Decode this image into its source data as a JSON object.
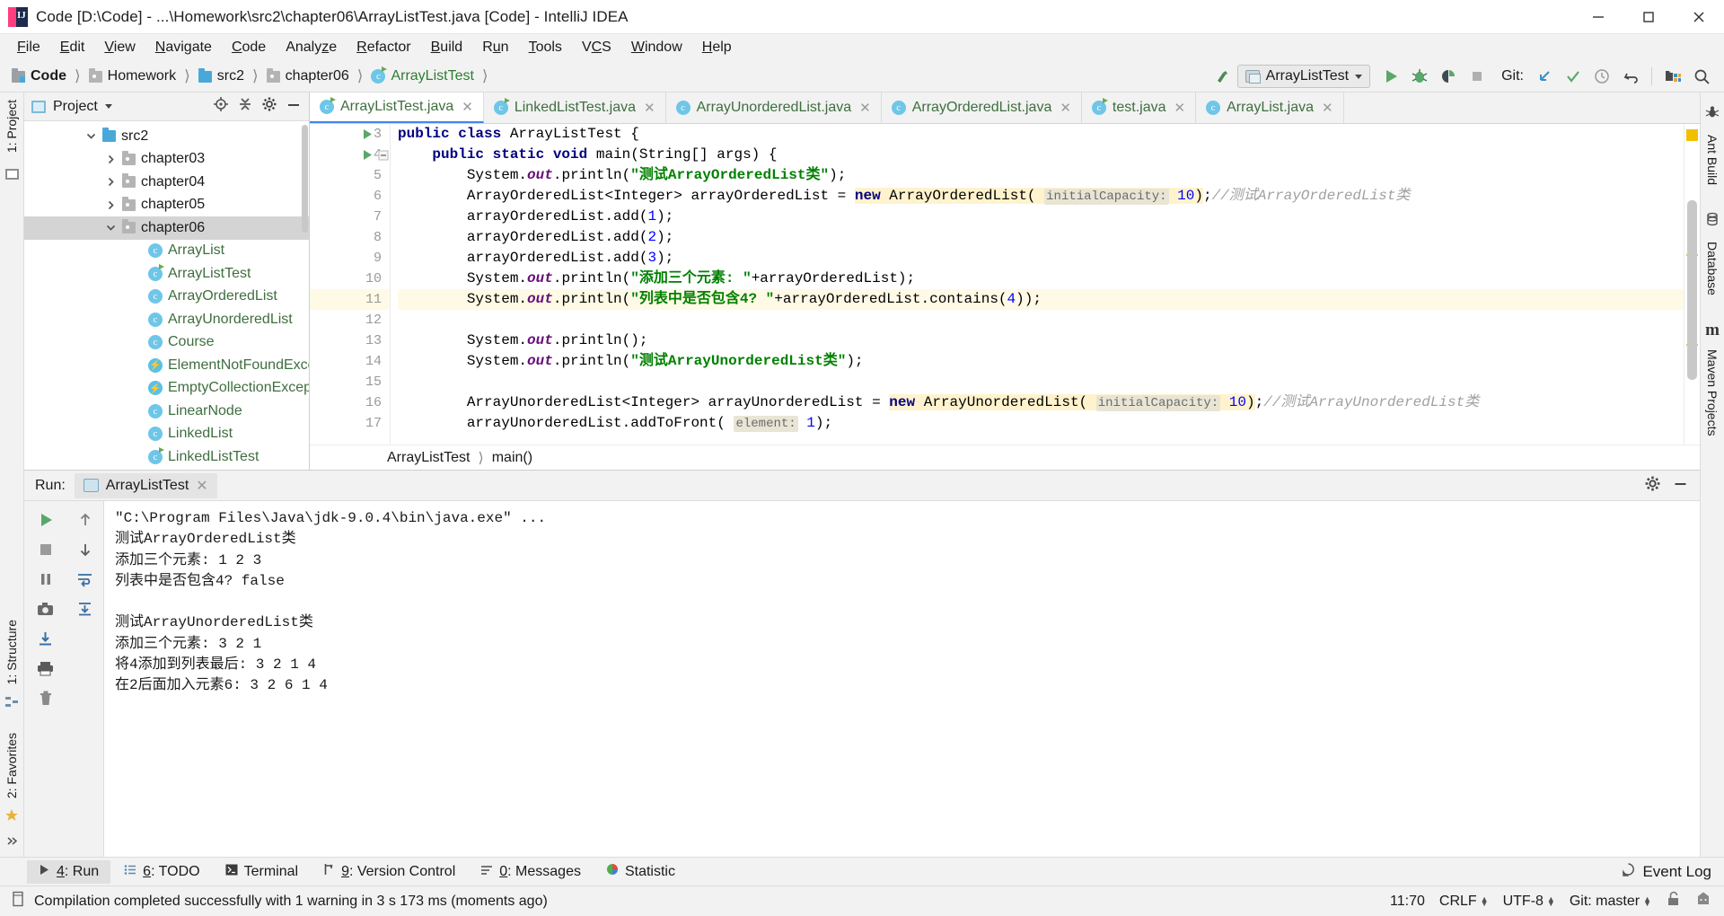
{
  "window": {
    "title": "Code [D:\\Code] - ...\\Homework\\src2\\chapter06\\ArrayListTest.java [Code] - IntelliJ IDEA",
    "minimize_label": "minimize-icon",
    "maximize_label": "maximize-icon",
    "close_label": "close-icon"
  },
  "menubar": {
    "items": [
      {
        "label": "File"
      },
      {
        "label": "Edit"
      },
      {
        "label": "View"
      },
      {
        "label": "Navigate"
      },
      {
        "label": "Code"
      },
      {
        "label": "Analyze"
      },
      {
        "label": "Refactor"
      },
      {
        "label": "Build"
      },
      {
        "label": "Run"
      },
      {
        "label": "Tools"
      },
      {
        "label": "VCS"
      },
      {
        "label": "Window"
      },
      {
        "label": "Help"
      }
    ]
  },
  "navbar": {
    "breadcrumbs": [
      {
        "label": "Code",
        "icon": "module-icon",
        "bold": true
      },
      {
        "label": "Homework",
        "icon": "folder-icon"
      },
      {
        "label": "src2",
        "icon": "source-folder-icon"
      },
      {
        "label": "chapter06",
        "icon": "package-icon"
      },
      {
        "label": "ArrayListTest",
        "icon": "java-class-icon",
        "green": true
      }
    ],
    "run_configuration": "ArrayListTest",
    "git_label": "Git:",
    "icons": [
      "build-icon",
      "run-icon",
      "debug-icon",
      "run-coverage-icon",
      "stop-icon",
      "git-update-icon",
      "git-commit-icon",
      "git-history-icon",
      "git-revert-icon",
      "select-in-icon",
      "search-everywhere-icon"
    ]
  },
  "left_rail": {
    "tabs": [
      {
        "label": "1: Project",
        "icon": "project-icon"
      },
      {
        "label": "1: Structure",
        "icon": "structure-icon"
      },
      {
        "label": "2: Favorites",
        "icon": "favorites-icon"
      }
    ]
  },
  "right_rail": {
    "tabs": [
      {
        "label": "Ant Build",
        "icon": "ant-icon"
      },
      {
        "label": "Database",
        "icon": "database-icon"
      },
      {
        "label": "Maven Projects",
        "icon": "maven-icon"
      }
    ]
  },
  "project_panel": {
    "title": "Project",
    "toolbar_icons": [
      "locate-icon",
      "collapse-all-icon",
      "gear-icon",
      "hide-icon"
    ],
    "tree": [
      {
        "label": "src2",
        "indent": 1,
        "twist": "open",
        "icon": "source-folder-icon",
        "selected": false
      },
      {
        "label": "chapter03",
        "indent": 2,
        "twist": "closed",
        "icon": "package-icon",
        "selected": false
      },
      {
        "label": "chapter04",
        "indent": 2,
        "twist": "closed",
        "icon": "package-icon",
        "selected": false
      },
      {
        "label": "chapter05",
        "indent": 2,
        "twist": "closed",
        "icon": "package-icon",
        "selected": false
      },
      {
        "label": "chapter06",
        "indent": 2,
        "twist": "open",
        "icon": "package-icon",
        "selected": true
      },
      {
        "label": "ArrayList",
        "indent": 3,
        "twist": "none",
        "icon": "java-class-icon",
        "selected": false
      },
      {
        "label": "ArrayListTest",
        "indent": 3,
        "twist": "none",
        "icon": "java-class-runnable-icon",
        "selected": false
      },
      {
        "label": "ArrayOrderedList",
        "indent": 3,
        "twist": "none",
        "icon": "java-class-icon",
        "selected": false
      },
      {
        "label": "ArrayUnorderedList",
        "indent": 3,
        "twist": "none",
        "icon": "java-class-icon",
        "selected": false
      },
      {
        "label": "Course",
        "indent": 3,
        "twist": "none",
        "icon": "java-class-icon",
        "selected": false
      },
      {
        "label": "ElementNotFoundExcep",
        "indent": 3,
        "twist": "none",
        "icon": "java-exception-icon",
        "selected": false
      },
      {
        "label": "EmptyCollectionExceptio",
        "indent": 3,
        "twist": "none",
        "icon": "java-exception-icon",
        "selected": false
      },
      {
        "label": "LinearNode",
        "indent": 3,
        "twist": "none",
        "icon": "java-class-icon",
        "selected": false
      },
      {
        "label": "LinkedList",
        "indent": 3,
        "twist": "none",
        "icon": "java-class-icon",
        "selected": false
      },
      {
        "label": "LinkedListTest",
        "indent": 3,
        "twist": "none",
        "icon": "java-class-runnable-icon",
        "selected": false
      }
    ]
  },
  "editor": {
    "tabs": [
      {
        "label": "ArrayListTest.java",
        "active": true,
        "icon": "java-class-runnable-icon"
      },
      {
        "label": "LinkedListTest.java",
        "active": false,
        "icon": "java-class-runnable-icon"
      },
      {
        "label": "ArrayUnorderedList.java",
        "active": false,
        "icon": "java-class-icon"
      },
      {
        "label": "ArrayOrderedList.java",
        "active": false,
        "icon": "java-class-icon"
      },
      {
        "label": "test.java",
        "active": false,
        "icon": "java-class-runnable-icon"
      },
      {
        "label": "ArrayList.java",
        "active": false,
        "icon": "java-class-icon"
      }
    ],
    "first_line_number": 3,
    "line_numbers": [
      3,
      4,
      5,
      6,
      7,
      8,
      9,
      10,
      11,
      12,
      13,
      14,
      15,
      16,
      17
    ],
    "breadcrumb_class": "ArrayListTest",
    "breadcrumb_method": "main()",
    "code_lines": [
      "public class ArrayListTest {",
      "    public static void main(String[] args) {",
      "        System.out.println(\"测试ArrayOrderedList类\");",
      "        ArrayOrderedList<Integer> arrayOrderedList = new ArrayOrderedList( initialCapacity: 10);//测试ArrayOrderedList",
      "        arrayOrderedList.add(1);",
      "        arrayOrderedList.add(2);",
      "        arrayOrderedList.add(3);",
      "        System.out.println(\"添加三个元素: \"+arrayOrderedList);",
      "        System.out.println(\"列表中是否包含4? \"+arrayOrderedList.contains(4));",
      "",
      "        System.out.println();",
      "        System.out.println(\"测试ArrayUnorderedList类\");",
      "",
      "        ArrayUnorderedList<Integer> arrayUnorderedList = new ArrayUnorderedList( initialCapacity: 10);//测试ArrayUnorderedList类",
      "        arrayUnorderedList.addToFront( element: 1);"
    ],
    "param_hints": [
      "initialCapacity:",
      "element:"
    ]
  },
  "run_panel": {
    "label": "Run:",
    "tab_label": "ArrayListTest",
    "header_icons": [
      "gear-icon",
      "hide-icon"
    ],
    "tool_icons": [
      "rerun-icon",
      "stop-icon",
      "pause-icon",
      "camera-icon",
      "export-icon",
      "print-icon",
      "trash-icon",
      "scroll-up-icon",
      "scroll-down-icon",
      "soft-wrap-icon"
    ],
    "console": [
      {
        "text": "\"C:\\Program Files\\Java\\jdk-9.0.4\\bin\\java.exe\" ...",
        "command": true
      },
      {
        "text": "测试ArrayOrderedList类",
        "command": false
      },
      {
        "text": "添加三个元素: 1 2 3",
        "command": false
      },
      {
        "text": "列表中是否包含4? false",
        "command": false
      },
      {
        "text": "",
        "command": false
      },
      {
        "text": "测试ArrayUnorderedList类",
        "command": false
      },
      {
        "text": "添加三个元素: 3 2 1",
        "command": false
      },
      {
        "text": "将4添加到列表最后: 3 2 1 4",
        "command": false
      },
      {
        "text": "在2后面加入元素6: 3 2 6 1 4",
        "command": false
      }
    ]
  },
  "tool_windows": {
    "items": [
      {
        "label": "4: Run",
        "active": true,
        "icon": "run-icon"
      },
      {
        "label": "6: TODO",
        "active": false,
        "icon": "todo-icon"
      },
      {
        "label": "Terminal",
        "active": false,
        "icon": "terminal-icon"
      },
      {
        "label": "9: Version Control",
        "active": false,
        "icon": "vcs-icon"
      },
      {
        "label": "0: Messages",
        "active": false,
        "icon": "messages-icon"
      },
      {
        "label": "Statistic",
        "active": false,
        "icon": "statistic-icon"
      }
    ],
    "event_log": "Event Log"
  },
  "status_bar": {
    "message": "Compilation completed successfully with 1 warning in 3 s 173 ms (moments ago)",
    "caret": "11:70",
    "line_separator": "CRLF",
    "encoding": "UTF-8",
    "branch": "Git: master",
    "icons": [
      "notification-icon",
      "lock-icon",
      "inspector-icon"
    ]
  },
  "colors": {
    "accent_blue": "#4285f4",
    "string_green": "#008000",
    "keyword_navy": "#000080",
    "number_blue": "#0000ff",
    "comment_grey": "#a0a0a0",
    "highlight_yellow": "#fffae6",
    "selection_grey": "#d4d4d4",
    "class_green": "#3f6e3f"
  }
}
